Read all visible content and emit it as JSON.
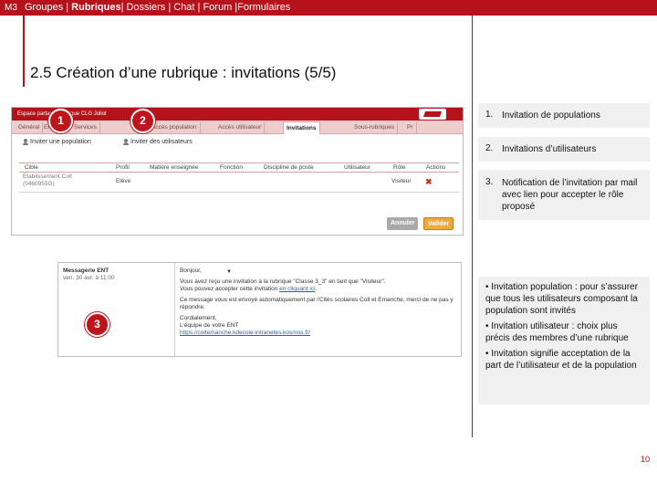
{
  "topbar": {
    "module": "M3",
    "nav_prefix": "Groupes | ",
    "nav_active": "Rubriques",
    "nav_suffix": "| Dossiers | Chat | Forum |Formulaires"
  },
  "title": "2.5 Création d’une rubrique : invitations (5/5)",
  "shot1": {
    "header_text": "Espace partagé Rubrique CLG Joliot",
    "tabs": [
      "Général",
      "Encadré",
      "Services",
      "Accès population",
      "Accès utilisateur",
      "Invitations",
      "Sous-rubriques",
      "Pr"
    ],
    "invite_population": "Inviter une population",
    "invite_users": "Inviter des utilisateurs",
    "columns": [
      "Cible",
      "Profil",
      "Matière enseignée",
      "Fonction",
      "Discipline de poste",
      "Utilisateur",
      "Rôle",
      "Actions"
    ],
    "row": {
      "cible": "Etablissement Coll (0460955G)",
      "profil": "Elève",
      "role": "Visiteur",
      "action_icon": "delete-x-icon"
    },
    "cancel_label": "Annuler",
    "validate_label": "Valider"
  },
  "shot3": {
    "from": "Messagerie ENT",
    "date": "ven. 30 avr. à 11:00",
    "greeting": "Bonjour,",
    "line1": "Vous avez reçu une invitation à la rubrique \"Classe 3_3\" en tant que \"Visiteur\".",
    "line2_prefix": "Vous pouvez accepter cette invitation ",
    "line2_link": "en cliquant ici",
    "line3": "Ce message vous est envoyé automatiquement par l'Cités scolaires Coll et Emanche, merci de ne pas y répondre.",
    "signature": "Cordialement,",
    "signature2": "L'équipe de votre ENT",
    "url": "https://coltemanche.kdecole-intranetes.kosmos.fr/"
  },
  "markers": [
    "1",
    "2",
    "3"
  ],
  "right": {
    "items": [
      {
        "num": "1.",
        "text": "Invitation de populations"
      },
      {
        "num": "2.",
        "text": "Invitations d’utilisateurs"
      },
      {
        "num": "3.",
        "text": "Notification de l’invitation  par mail avec lien pour accepter le rôle proposé"
      }
    ],
    "bullets": [
      "• Invitation population : pour s’assurer que tous les utilisateurs composant la population sont invités",
      "• Invitation utilisateur : choix plus précis des membres d’une rubrique",
      "• Invitation signifie acceptation de la part de l’utilisateur et de la population"
    ]
  },
  "page_number": "10",
  "colors": {
    "brand": "#b5121b",
    "panel": "#f0f0f0",
    "validate": "#f0a93a"
  }
}
